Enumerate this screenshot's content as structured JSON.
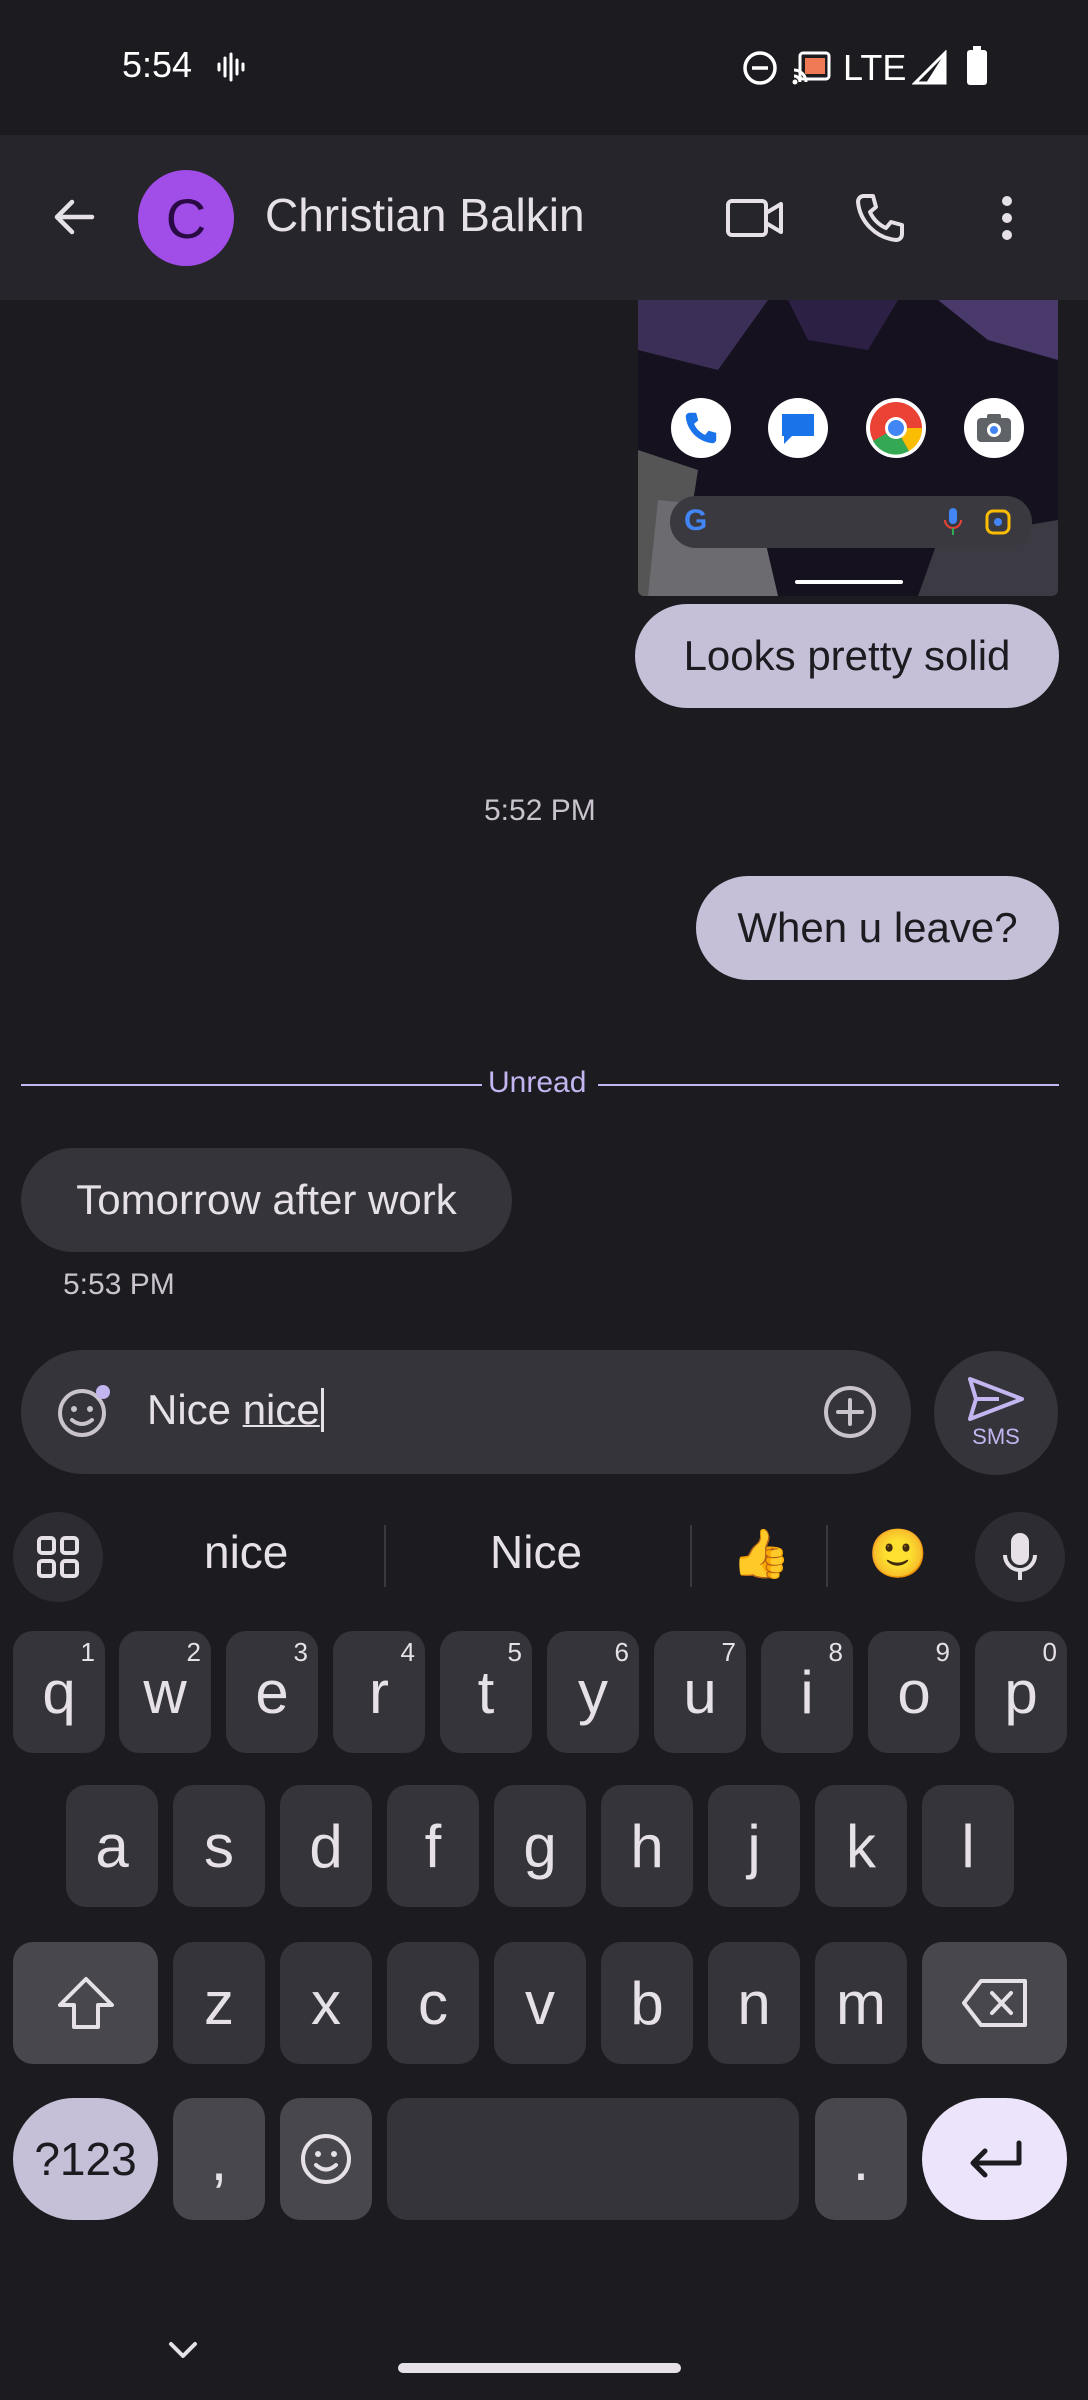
{
  "status_bar": {
    "time": "5:54",
    "icons": [
      "voicemail-waveform-icon",
      "do-not-disturb-icon",
      "cast-icon",
      "signal-icon",
      "battery-icon"
    ],
    "network": "LTE"
  },
  "header": {
    "avatar_letter": "C",
    "contact_name": "Christian Balkin",
    "actions": [
      "video-call-icon",
      "phone-call-icon",
      "more-options-icon"
    ],
    "colors": {
      "avatar_bg": "#a14de8"
    }
  },
  "conversation": {
    "messages": [
      {
        "direction": "outgoing",
        "type": "image",
        "depicts": "home-screen-screenshot"
      },
      {
        "direction": "outgoing",
        "text": "Looks pretty solid"
      },
      {
        "direction": "outgoing",
        "text": "When u leave?",
        "timestamp": "5:52 PM"
      },
      {
        "direction": "incoming",
        "text": "Tomorrow after work",
        "timestamp": "5:53 PM"
      }
    ],
    "unread_divider": "Unread"
  },
  "compose": {
    "text_plain": "Nice ",
    "text_composing": "nice",
    "send_label": "SMS"
  },
  "keyboard": {
    "suggestions": [
      "nice",
      "Nice",
      "👍",
      "🙂"
    ],
    "rows": [
      [
        {
          "label": "q",
          "hint": "1"
        },
        {
          "label": "w",
          "hint": "2"
        },
        {
          "label": "e",
          "hint": "3"
        },
        {
          "label": "r",
          "hint": "4"
        },
        {
          "label": "t",
          "hint": "5"
        },
        {
          "label": "y",
          "hint": "6"
        },
        {
          "label": "u",
          "hint": "7"
        },
        {
          "label": "i",
          "hint": "8"
        },
        {
          "label": "o",
          "hint": "9"
        },
        {
          "label": "p",
          "hint": "0"
        }
      ],
      [
        "a",
        "s",
        "d",
        "f",
        "g",
        "h",
        "j",
        "k",
        "l"
      ],
      [
        "z",
        "x",
        "c",
        "v",
        "b",
        "n",
        "m"
      ]
    ],
    "mode_key": "?123",
    "comma": ",",
    "period": ".",
    "colors": {
      "accent": "#c3b5f0",
      "enter_bg": "#ebe4fb"
    }
  }
}
